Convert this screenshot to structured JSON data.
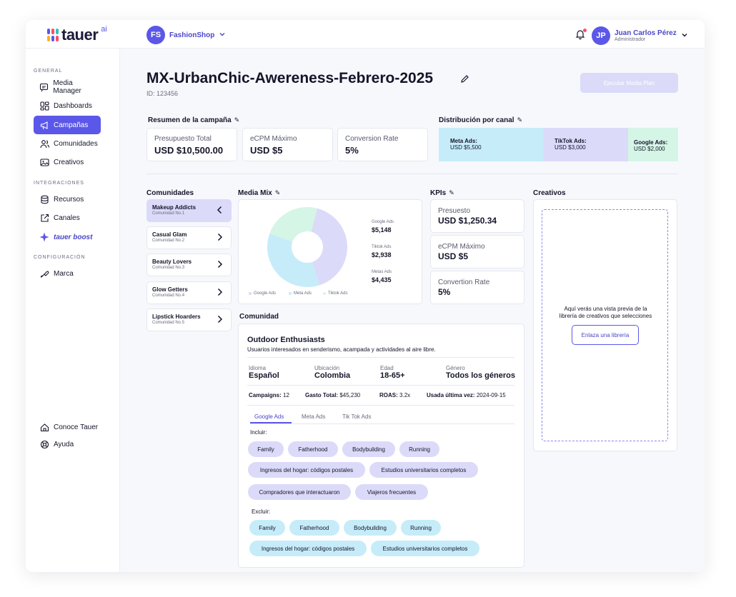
{
  "app": {
    "logo_text": "tauer",
    "logo_ai": "ai"
  },
  "header": {
    "shop_initials": "FS",
    "shop_name": "FashionShop",
    "user_initials": "JP",
    "user_name": "Juan Carlos Pérez",
    "user_role": "Administrador"
  },
  "sidebar": {
    "general_label": "GENERAL",
    "integraciones_label": "INTEGRACIONES",
    "configuracion_label": "CONFIGURACIÓN",
    "items": [
      {
        "label": "Media Manager",
        "icon": "chat-icon"
      },
      {
        "label": "Dashboards",
        "icon": "grid-icon"
      },
      {
        "label": "Campañas",
        "icon": "megaphone-icon"
      },
      {
        "label": "Comunidades",
        "icon": "users-icon"
      },
      {
        "label": "Creativos",
        "icon": "image-icon"
      },
      {
        "label": "Recursos",
        "icon": "database-icon"
      },
      {
        "label": "Canales",
        "icon": "external-link-icon"
      },
      {
        "label": "tauer boost",
        "icon": "sparkle-icon"
      },
      {
        "label": "Marca",
        "icon": "palette-icon"
      }
    ],
    "footer": [
      {
        "label": "Conoce Tauer",
        "icon": "home-icon"
      },
      {
        "label": "Ayuda",
        "icon": "lifebuoy-icon"
      }
    ]
  },
  "campaign": {
    "title": "MX-UrbanChic-Awereness-Febrero-2025",
    "id_text": "ID: 123456",
    "execute_button": "Ejecutar Media Plan"
  },
  "summary": {
    "heading": "Resumen  de la campaña",
    "cards": [
      {
        "label": "Presupuesto Total",
        "value": "USD $10,500.00"
      },
      {
        "label": "eCPM Máximo",
        "value": "USD $5"
      },
      {
        "label": "Conversion Rate",
        "value": "5%"
      }
    ]
  },
  "distribution": {
    "heading": "Distribución por canal",
    "channels": [
      {
        "name": "Meta Ads:",
        "value": "USD $5,500",
        "amount": 5500,
        "color": "#c6ecf9"
      },
      {
        "name": "TikTok Ads:",
        "value": "USD $3,000",
        "amount": 3000,
        "color": "#dcdaf9"
      },
      {
        "name": "Google Ads:",
        "value": "USD $2,000",
        "amount": 2000,
        "color": "#d5f5e6"
      }
    ]
  },
  "communities": {
    "heading": "Comunidades",
    "items": [
      {
        "name": "Makeup Addicts",
        "sub": "Comunidad No.1"
      },
      {
        "name": "Casual Glam",
        "sub": "Comunidad No.2"
      },
      {
        "name": "Beauty Lovers",
        "sub": "Comunidad No.3"
      },
      {
        "name": "Glow Getters",
        "sub": "Comunidad No.4"
      },
      {
        "name": "Lipstick Hoarders",
        "sub": "Comunidad No.5"
      }
    ]
  },
  "media_mix": {
    "heading": "Media Mix",
    "labels": [
      {
        "name": "Google Ads",
        "value": "$5,148"
      },
      {
        "name": "Tiktok Ads",
        "value": "$2,938"
      },
      {
        "name": "Metas Ads",
        "value": "$4,435"
      }
    ],
    "legend": [
      "Google Ads",
      "Meta Ads",
      "Tiktok Ads"
    ]
  },
  "chart_data": {
    "type": "pie",
    "categories": [
      "Google Ads",
      "Metas Ads",
      "Tiktok Ads"
    ],
    "values": [
      5148,
      4435,
      2938
    ],
    "colors": [
      "#dcdaf9",
      "#c6ecf9",
      "#d5f5e6"
    ]
  },
  "kpis": {
    "heading": "KPIs",
    "cards": [
      {
        "label": "Presuesto",
        "value": "USD $1,250.34"
      },
      {
        "label": "eCPM Máximo",
        "value": "USD $5"
      },
      {
        "label": "Convertion Rate",
        "value": "5%"
      }
    ]
  },
  "creatives": {
    "heading": "Creativos",
    "empty_text_1": "Aquí verás una vista previa de la",
    "empty_text_2": "librería de creativos que selecciones",
    "link_button": "Enlaza una librería"
  },
  "community_detail": {
    "heading": "Comunidad",
    "title": "Outdoor Enthusiasts",
    "description": "Usuarios interesados en senderismo, acampada y actividades al aire libre.",
    "attributes": [
      {
        "label": "Idioma",
        "value": "Español"
      },
      {
        "label": "Ubicación",
        "value": "Colombia"
      },
      {
        "label": "Edad",
        "value": "18-65+"
      },
      {
        "label": "Género",
        "value": "Todos los géneros"
      }
    ],
    "stats": [
      {
        "label": "Campaigns:",
        "value": "12"
      },
      {
        "label": "Gasto Total:",
        "value": "$45,230"
      },
      {
        "label": "ROAS:",
        "value": "3.2x"
      },
      {
        "label": "Usada última vez:",
        "value": "2024-09-15"
      }
    ],
    "tabs": [
      "Google Ads",
      "Meta Ads",
      "Tik Tok Ads"
    ],
    "include_label": "Incluir:",
    "exclude_label": "Excluir:",
    "include_chips": [
      "Family",
      "Fatherhood",
      "Bodybuilding",
      "Running",
      "Ingresos del hogar: códigos postales",
      "Estudios universitarios completos",
      "Compradores que interactuaron",
      "Viajeros frecuentes"
    ],
    "exclude_chips": [
      "Family",
      "Fatherhood",
      "Bodybuilding",
      "Running",
      "Ingresos del hogar: códigos postales",
      "Estudios universitarios completos"
    ]
  },
  "colors": {
    "accent": "#5b57e8",
    "accent_light": "#dcdaf9",
    "cyan_light": "#c6ecf9",
    "green_light": "#d5f5e6"
  }
}
